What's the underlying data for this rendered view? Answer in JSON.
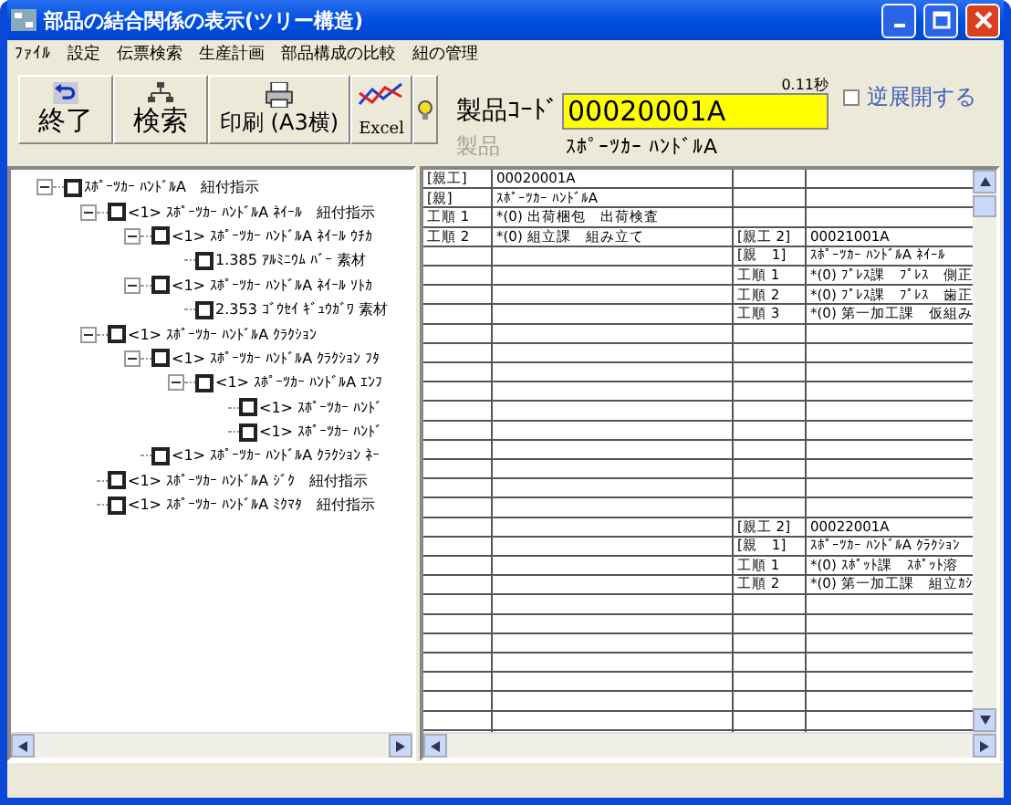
{
  "window": {
    "title": "部品の結合関係の表示(ツリー構造)"
  },
  "menu": [
    "ﾌｧｲﾙ",
    "設定",
    "伝票検索",
    "生産計画",
    "部品構成の比較",
    "紐の管理"
  ],
  "toolbar": [
    {
      "kind": "undo",
      "label": "終了"
    },
    {
      "kind": "search",
      "label": "検索"
    },
    {
      "kind": "print",
      "label": "印刷 (A3横)"
    },
    {
      "kind": "excel",
      "label": "Excel"
    },
    {
      "kind": "help"
    }
  ],
  "product": {
    "elapsed": "0.11秒",
    "code_label": "製品ｺｰﾄﾞ",
    "code": "00020001A",
    "name_label": "製品",
    "name": "ｽﾎﾟｰﾂｶｰ ﾊﾝﾄﾞﾙA"
  },
  "reverse": {
    "label": "逆展開する",
    "checked": false
  },
  "tree": [
    {
      "label": "ｽﾎﾟｰﾂｶｰ ﾊﾝﾄﾞﾙA　紐付指示",
      "checked": false,
      "expanded": true,
      "children": [
        {
          "label": "<1> ｽﾎﾟｰﾂｶｰ ﾊﾝﾄﾞﾙA ﾈｲｰﾙ　紐付指示",
          "checked": false,
          "expanded": true,
          "children": [
            {
              "label": "<1> ｽﾎﾟｰﾂｶｰ ﾊﾝﾄﾞﾙA ﾈｲｰﾙ ｳﾁｶ",
              "checked": false,
              "expanded": true,
              "children": [
                {
                  "label": "1.385 ｱﾙﾐﾆｳﾑ ﾊﾞｰ 素材",
                  "checked": false
                }
              ]
            },
            {
              "label": "<1> ｽﾎﾟｰﾂｶｰ ﾊﾝﾄﾞﾙA ﾈｲｰﾙ ｿﾄｶ",
              "checked": false,
              "expanded": true,
              "children": [
                {
                  "label": "2.353 ｺﾞｳｾｲ ｷﾞｭｳｶﾞﾜ 素材",
                  "checked": false
                }
              ]
            }
          ]
        },
        {
          "label": "<1> ｽﾎﾟｰﾂｶｰ ﾊﾝﾄﾞﾙA ｸﾗｸｼｮﾝ",
          "checked": false,
          "expanded": true,
          "children": [
            {
              "label": "<1> ｽﾎﾟｰﾂｶｰ ﾊﾝﾄﾞﾙA ｸﾗｸｼｮﾝ ﾌﾀ",
              "checked": false,
              "expanded": true,
              "children": [
                {
                  "label": "<1> ｽﾎﾟｰﾂｶｰ ﾊﾝﾄﾞﾙA ｴﾝﾌ",
                  "checked": false,
                  "expanded": true,
                  "children": [
                    {
                      "label": "<1> ｽﾎﾟｰﾂｶｰ ﾊﾝﾄﾞ",
                      "checked": false
                    },
                    {
                      "label": "<1> ｽﾎﾟｰﾂｶｰ ﾊﾝﾄﾞ",
                      "checked": false
                    }
                  ]
                }
              ]
            },
            {
              "label": "<1> ｽﾎﾟｰﾂｶｰ ﾊﾝﾄﾞﾙA ｸﾗｸｼｮﾝ ﾈｰ",
              "checked": false
            }
          ]
        },
        {
          "label": "<1> ｽﾎﾟｰﾂｶｰ ﾊﾝﾄﾞﾙA ｼﾞｸ　紐付指示",
          "checked": false
        },
        {
          "label": "<1> ｽﾎﾟｰﾂｶｰ ﾊﾝﾄﾞﾙA ﾐｸﾏﾀ　紐付指示",
          "checked": false
        }
      ]
    }
  ],
  "grid": {
    "rows": [
      {
        "column_1": "[親工]",
        "column_2": "00020001A"
      },
      {
        "column_1": "[親]",
        "column_2": "ｽﾎﾟｰﾂｶｰ ﾊﾝﾄﾞﾙA"
      },
      {
        "column_1": "工順 1",
        "column_2": "*(0) 出荷梱包　出荷検査"
      },
      {
        "column_1": "工順 2",
        "column_2": "*(0) 組立課　組み立て",
        "column_3": "[親工 2]",
        "column_4": "00021001A"
      },
      {
        "column_3": "[親　1]",
        "column_4": "ｽﾎﾟｰﾂｶｰ ﾊﾝﾄﾞﾙA ﾈｲｰﾙ"
      },
      {
        "column_3": "工順 1",
        "column_4": "*(0) ﾌﾟﾚｽ課　ﾌﾟﾚｽ　側正"
      },
      {
        "column_3": "工順 2",
        "column_4": "*(0) ﾌﾟﾚｽ課　ﾌﾟﾚｽ　歯正"
      },
      {
        "column_3": "工順 3",
        "column_4": "*(0) 第一加工課　仮組み"
      },
      {},
      {},
      {},
      {},
      {},
      {},
      {},
      {},
      {},
      {},
      {
        "column_3": "[親工 2]",
        "column_4": "00022001A"
      },
      {
        "column_3": "[親　1]",
        "column_4": "ｽﾎﾟｰﾂｶｰ ﾊﾝﾄﾞﾙA ｸﾗｸｼｮﾝ"
      },
      {
        "column_3": "工順 1",
        "column_4": "*(0) ｽﾎﾟｯﾄ課　ｽﾎﾟｯﾄ溶"
      },
      {
        "column_3": "工順 2",
        "column_4": "*(0) 第一加工課　組立ｶｼ"
      }
    ]
  }
}
